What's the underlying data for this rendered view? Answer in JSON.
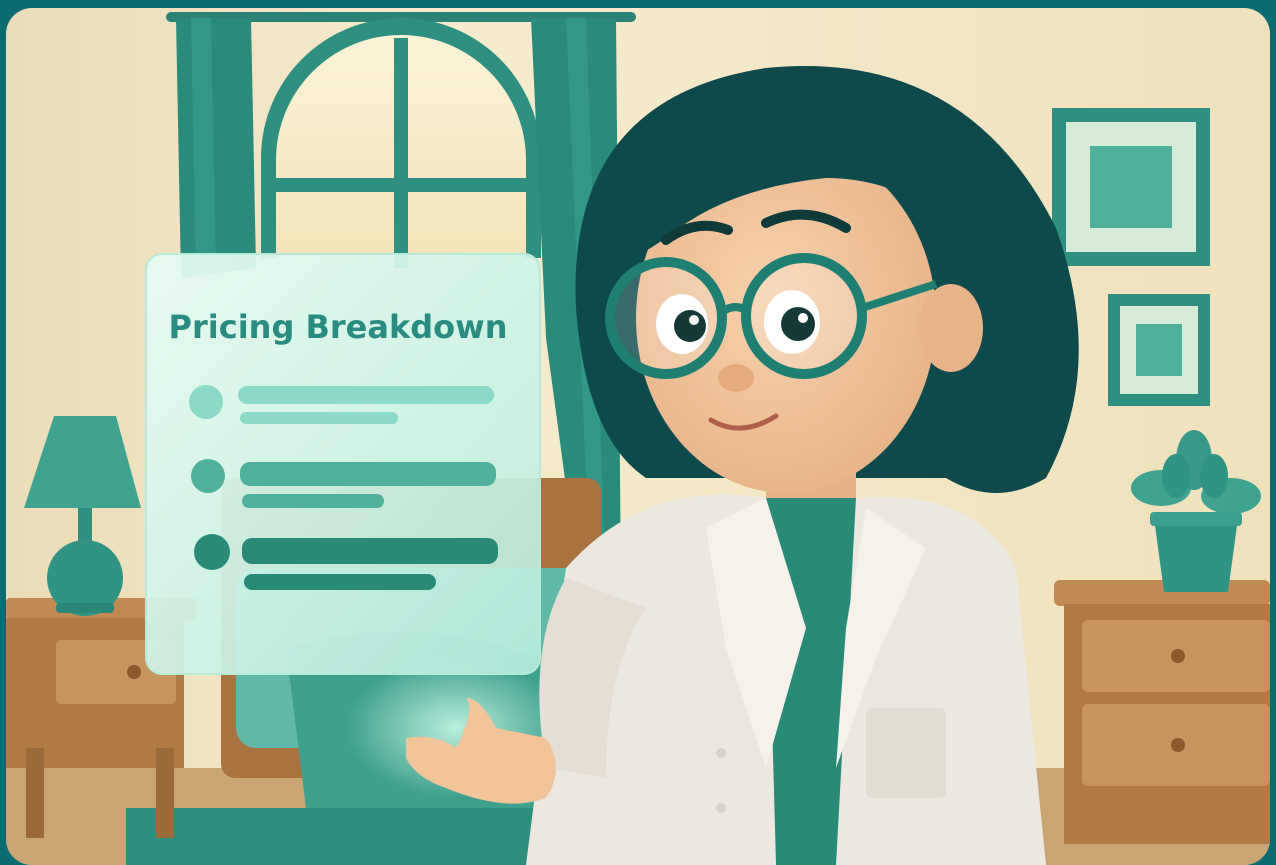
{
  "panel": {
    "title": "Pricing Breakdown"
  },
  "colors": {
    "frame": "#0a6b72",
    "wall": "#f0e6c8",
    "teal": "#2f9a88",
    "teal_dark": "#1f7a6a",
    "panel_glass": "#d8f3ea",
    "panel_title": "#2a8c80",
    "coat": "#ece8e0",
    "hair": "#0e4a4c",
    "skin": "#f1c49a",
    "wood": "#b5804a"
  }
}
